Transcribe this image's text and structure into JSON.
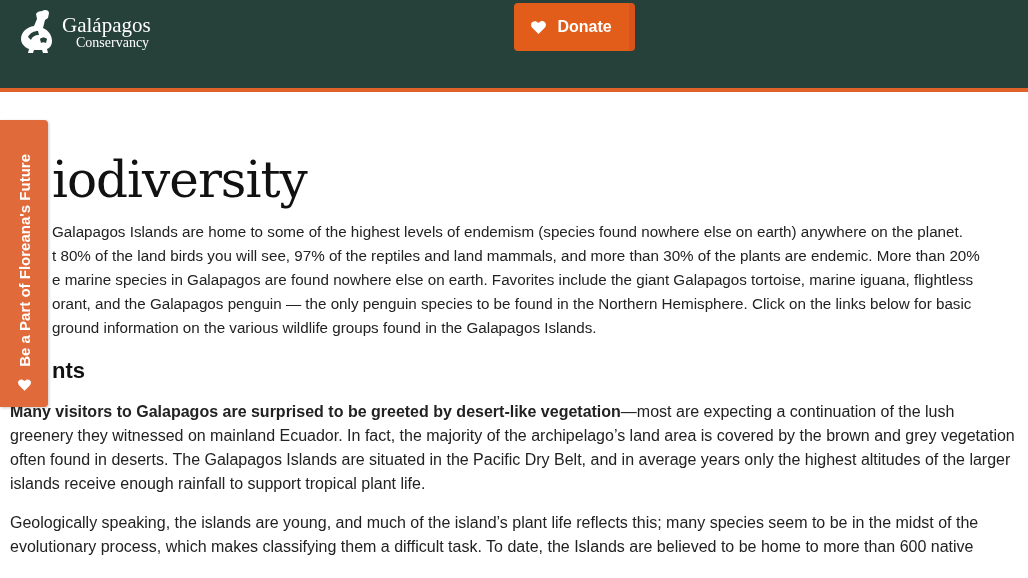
{
  "header": {
    "logo": {
      "name": "Galápagos",
      "subtitle": "Conservancy"
    },
    "donate_button": {
      "label": "Donate"
    }
  },
  "side_tab": {
    "label": "Be a Part of Floreana's Future"
  },
  "title": "iodiversity",
  "intro_lines": [
    "Galapagos Islands are home to some of the highest levels of endemism (species found nowhere else on earth) anywhere on the planet.",
    "t 80% of the land birds you will see, 97% of the reptiles and land mammals, and more than 30% of the plants are endemic. More than 20%",
    "e marine species in Galapagos are found nowhere else on earth. Favorites include the giant Galapagos tortoise, marine iguana, flightless",
    "orant, and the Galapagos penguin — the only penguin species to be found in the Northern Hemisphere. Click on the links below for basic",
    "ground information on the various wildlife groups found in the Galapagos Islands."
  ],
  "section": {
    "heading": "nts",
    "paragraphs": [
      "**Many visitors to Galapagos are surprised to be greeted by desert-like vegetation**—most are expecting a continuation of the lush greenery they witnessed on mainland Ecuador. In fact, the majority of the archipelago’s land area is covered by the brown and grey vegetation often found in deserts. The Galapagos Islands are situated in the Pacific Dry Belt, and in average years only the highest altitudes of the larger islands receive enough rainfall to support tropical plant life.",
      "Geologically speaking, the islands are young, and much of the island’s plant life reflects this; many species seem to be in the midst of the evolutionary process, which makes classifying them a difficult task. To date, the Islands are believed to be home to more than 600 native"
    ]
  }
}
